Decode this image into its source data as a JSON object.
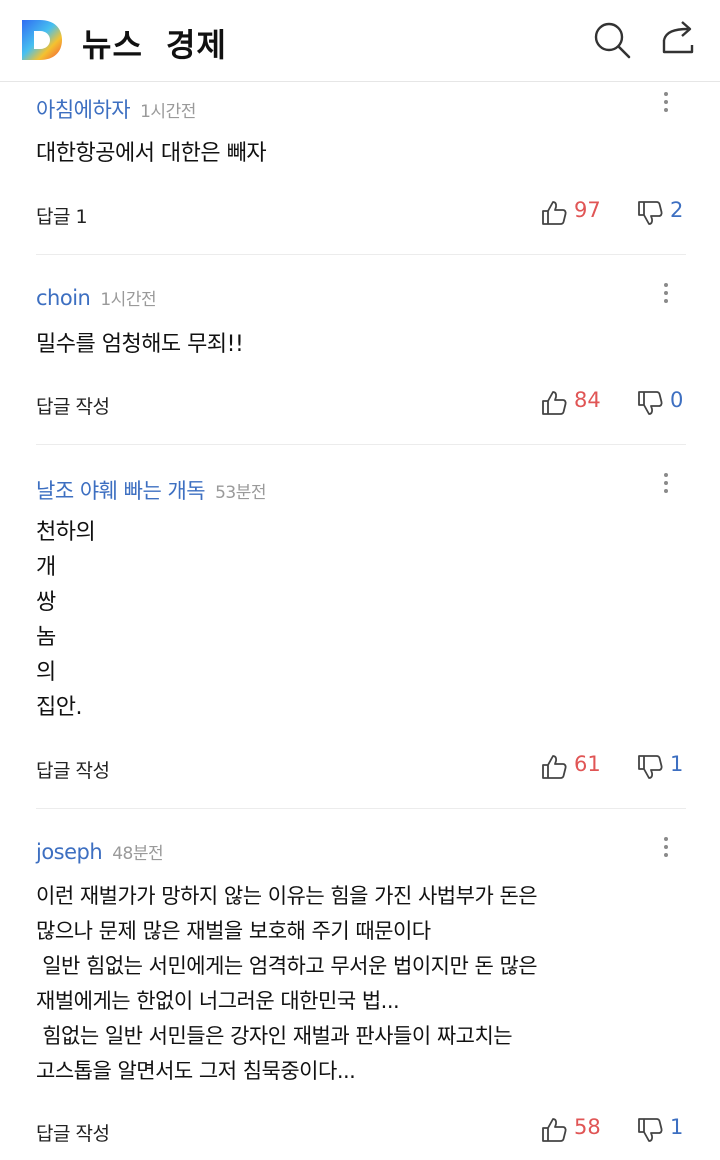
{
  "header": {
    "logo_letter": "D",
    "title": "뉴스",
    "section": "경제"
  },
  "comments": [
    {
      "author": "아침에하자",
      "time": "1시간전",
      "text": "대한항공에서 대한은 빼자",
      "reply": "답글 1",
      "likes": "97",
      "dislikes": "2"
    },
    {
      "author": "choin",
      "time": "1시간전",
      "text": "밀수를 엄청해도 무죄!!",
      "reply": "답글 작성",
      "likes": "84",
      "dislikes": "0"
    },
    {
      "author": "날조 야훼 빠는 개독",
      "time": "53분전",
      "text": "천하의\n개\n쌍\n놈\n의\n집안.",
      "reply": "답글 작성",
      "likes": "61",
      "dislikes": "1"
    },
    {
      "author": "joseph",
      "time": "48분전",
      "text": "이런 재벌가가 망하지 않는 이유는 힘을 가진 사법부가 돈은\n많으나 문제 많은 재벌을 보호해 주기 때문이다\n 일반 힘없는 서민에게는 엄격하고 무서운 법이지만 돈 많은\n재벌에게는 한없이 너그러운 대한민국 법...\n 힘없는 일반 서민들은 강자인 재벌과 판사들이 짜고치는\n고스톱을 알면서도 그저 침묵중이다...",
      "reply": "답글 작성",
      "likes": "58",
      "dislikes": "1"
    }
  ],
  "colors": {
    "author": "#3d6fc1",
    "like": "#e05555",
    "dislike": "#3d6fc1"
  }
}
